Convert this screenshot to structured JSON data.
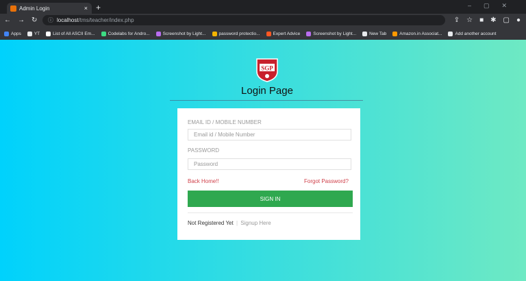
{
  "browser": {
    "tab_title": "Admin Login",
    "tab_close": "×",
    "new_tab": "+",
    "url_host": "localhost",
    "url_path": "/tms/teacher/index.php",
    "bookmarks": [
      {
        "label": "Apps",
        "color": "#4285f4"
      },
      {
        "label": "YT",
        "color": "#e8eaed"
      },
      {
        "label": "List of All ASCII Em...",
        "color": "#ffffff"
      },
      {
        "label": "Codelabs for Andro...",
        "color": "#3ddc84"
      },
      {
        "label": "Screenshot by Light...",
        "color": "#b96df0"
      },
      {
        "label": "password protectio...",
        "color": "#f4b400"
      },
      {
        "label": "Expert Advice",
        "color": "#ff5722"
      },
      {
        "label": "Screenshot by Light...",
        "color": "#b96df0"
      },
      {
        "label": "New Tab",
        "color": "#e8eaed"
      },
      {
        "label": "Amazon.in Associat...",
        "color": "#ff9900"
      },
      {
        "label": "Add another account",
        "color": "#e8eaed"
      }
    ]
  },
  "page": {
    "logo_text": "SGP",
    "heading": "Login Page",
    "email_label": "EMAIL ID / MOBILE NUMBER",
    "email_placeholder": "Email id / Mobile Number",
    "password_label": "PASSWORD",
    "password_placeholder": "Password",
    "back_home": "Back Home!!",
    "forgot_password": "Forgot Password?",
    "sign_in": "SIGN IN",
    "not_registered": "Not Registered Yet",
    "separator": "|",
    "signup": "Signup Here"
  },
  "colors": {
    "gradient_start": "#00d2fc",
    "gradient_end": "#6ee9c3",
    "button": "#2fa84f",
    "link_red": "#d0404a",
    "logo_red": "#c8202c"
  }
}
